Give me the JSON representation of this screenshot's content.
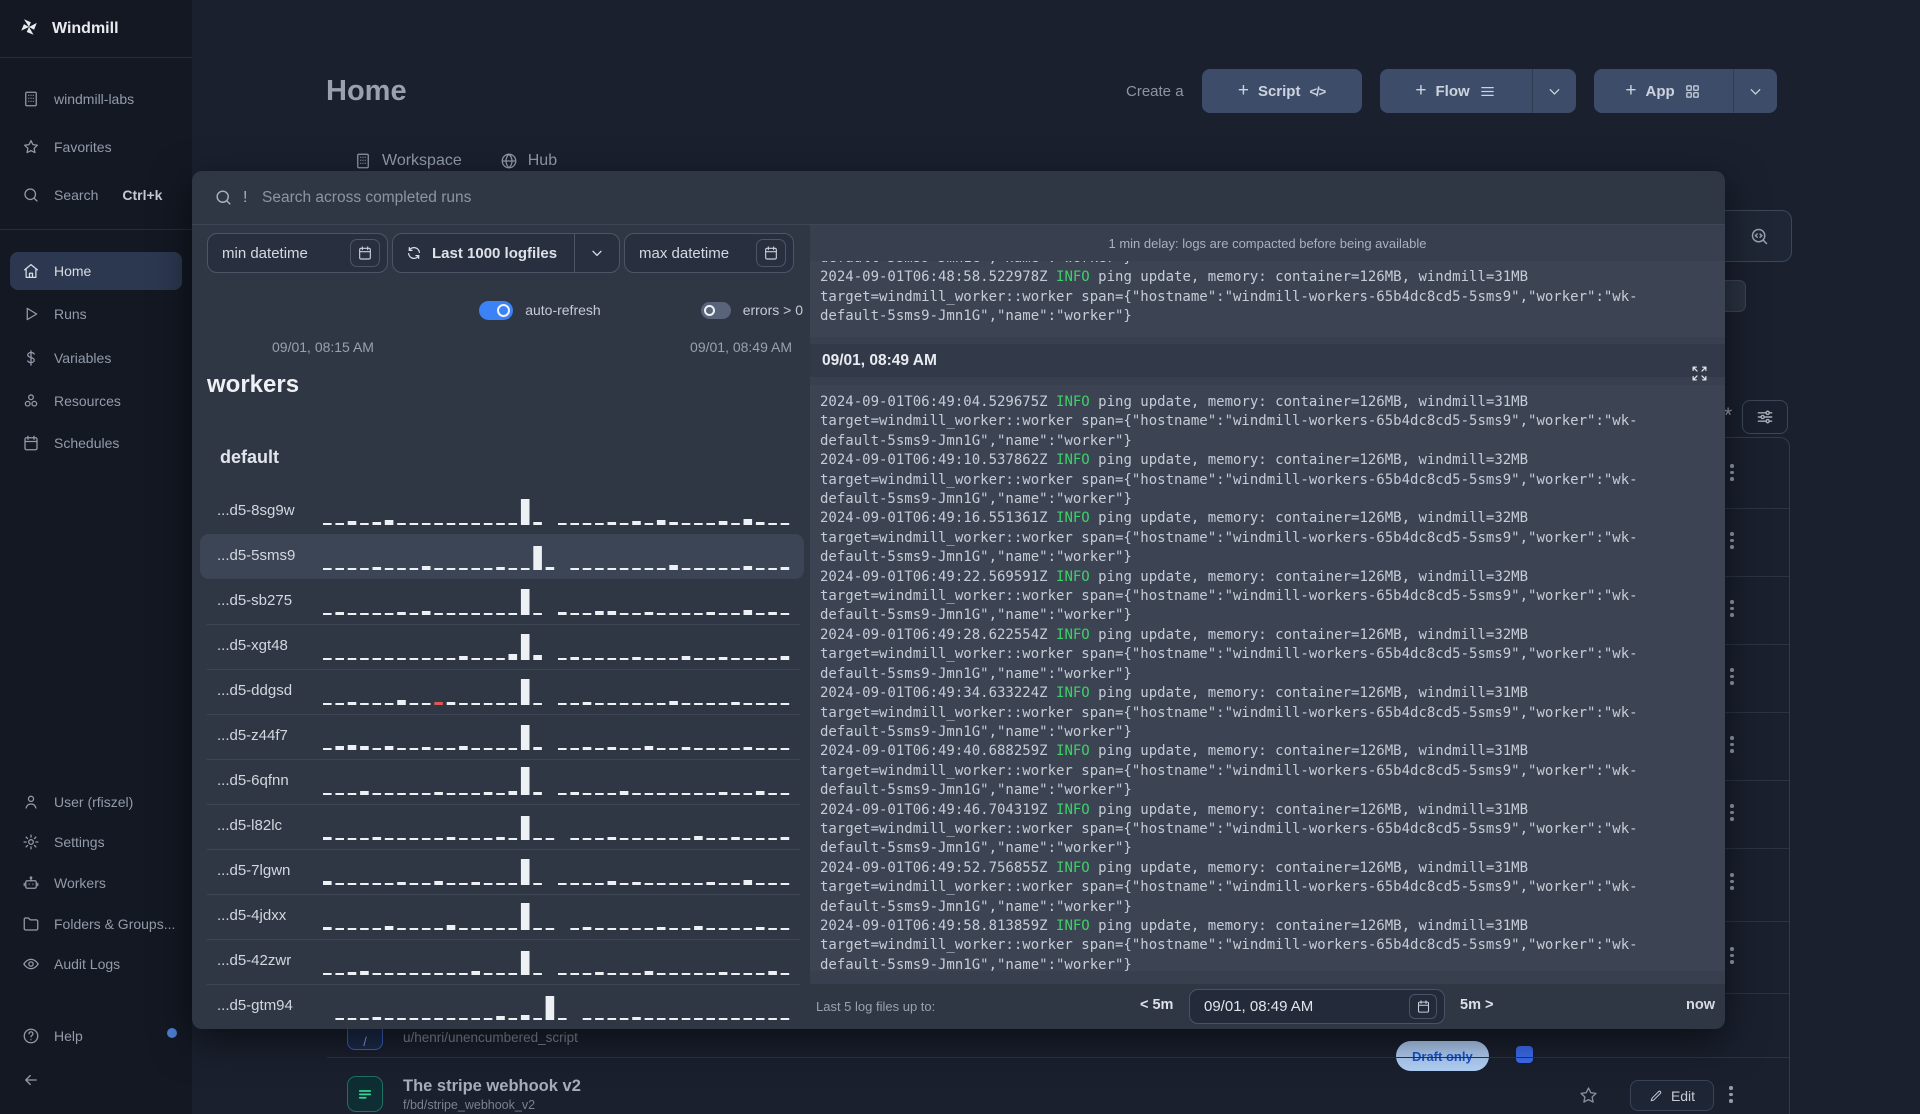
{
  "sidebar": {
    "brand": "Windmill",
    "top_items": [
      {
        "label": "windmill-labs",
        "icon": "building"
      },
      {
        "label": "Favorites",
        "icon": "star"
      },
      {
        "label": "Search",
        "icon": "search",
        "shortcut": "Ctrl+k"
      }
    ],
    "nav_items": [
      {
        "label": "Home",
        "icon": "home",
        "active": true
      },
      {
        "label": "Runs",
        "icon": "play"
      },
      {
        "label": "Variables",
        "icon": "dollar"
      },
      {
        "label": "Resources",
        "icon": "nodes"
      },
      {
        "label": "Schedules",
        "icon": "calendar"
      }
    ],
    "bottom_items": [
      {
        "label": "User (rfiszel)",
        "icon": "user"
      },
      {
        "label": "Settings",
        "icon": "gear"
      },
      {
        "label": "Workers",
        "icon": "robot"
      },
      {
        "label": "Folders & Groups...",
        "icon": "folder"
      },
      {
        "label": "Audit Logs",
        "icon": "eye"
      }
    ],
    "help_label": "Help"
  },
  "header": {
    "title": "Home",
    "create_label": "Create a",
    "script_label": "Script",
    "script_glyph": "</>",
    "flow_label": "Flow",
    "app_label": "App"
  },
  "tabs": [
    {
      "label": "Workspace",
      "icon": "building"
    },
    {
      "label": "Hub",
      "icon": "globe"
    }
  ],
  "modal": {
    "search_prefix": "!",
    "search_placeholder": "Search across completed runs",
    "filters": {
      "min_datetime": "min datetime",
      "logfiles": "Last 1000 logfiles",
      "max_datetime": "max datetime",
      "auto_refresh": "auto-refresh",
      "errors": "errors > 0"
    },
    "range": {
      "start": "09/01, 08:15 AM",
      "end": "09/01, 08:49 AM"
    },
    "workers": {
      "title": "workers",
      "group": "default",
      "rows": [
        {
          "id": "...d5-8sg9w",
          "selected": false,
          "bars": [
            2,
            2,
            4,
            2,
            3,
            5,
            2,
            2,
            2,
            2,
            2,
            2,
            2,
            2,
            2,
            2,
            26,
            3,
            0,
            2,
            2,
            2,
            2,
            3,
            2,
            4,
            2,
            5,
            3,
            2,
            2,
            2,
            4,
            2,
            6,
            3,
            2,
            2
          ]
        },
        {
          "id": "...d5-5sms9",
          "selected": true,
          "bars": [
            2,
            2,
            2,
            2,
            3,
            2,
            2,
            2,
            4,
            2,
            2,
            2,
            2,
            2,
            3,
            2,
            2,
            24,
            3,
            0,
            2,
            2,
            2,
            2,
            2,
            2,
            2,
            2,
            5,
            2,
            2,
            2,
            2,
            2,
            4,
            2,
            2,
            3
          ]
        },
        {
          "id": "...d5-sb275",
          "selected": false,
          "bars": [
            2,
            3,
            2,
            2,
            2,
            2,
            3,
            2,
            4,
            2,
            2,
            2,
            2,
            2,
            2,
            2,
            26,
            2,
            0,
            3,
            2,
            2,
            4,
            4,
            2,
            2,
            3,
            2,
            2,
            2,
            2,
            3,
            2,
            2,
            5,
            2,
            3,
            2
          ]
        },
        {
          "id": "...d5-xgt48",
          "selected": false,
          "bars": [
            2,
            2,
            2,
            2,
            2,
            2,
            2,
            2,
            2,
            2,
            2,
            4,
            2,
            2,
            2,
            6,
            26,
            5,
            0,
            2,
            3,
            2,
            2,
            2,
            2,
            3,
            2,
            2,
            2,
            4,
            2,
            2,
            3,
            2,
            2,
            2,
            2,
            4
          ]
        },
        {
          "id": "...d5-ddgsd",
          "selected": false,
          "bars": [
            2,
            2,
            3,
            2,
            2,
            2,
            5,
            2,
            2,
            -2,
            3,
            2,
            2,
            2,
            2,
            2,
            26,
            2,
            0,
            2,
            2,
            3,
            2,
            2,
            2,
            2,
            2,
            2,
            4,
            2,
            2,
            2,
            2,
            3,
            2,
            2,
            2,
            2
          ]
        },
        {
          "id": "...d5-z44f7",
          "selected": false,
          "bars": [
            2,
            4,
            5,
            4,
            2,
            4,
            2,
            2,
            3,
            2,
            2,
            4,
            2,
            2,
            2,
            2,
            25,
            3,
            0,
            2,
            2,
            3,
            2,
            3,
            2,
            2,
            4,
            2,
            2,
            3,
            2,
            2,
            2,
            2,
            3,
            2,
            2,
            2
          ]
        },
        {
          "id": "...d5-6qfnn",
          "selected": false,
          "bars": [
            2,
            2,
            2,
            4,
            2,
            2,
            2,
            2,
            2,
            3,
            2,
            2,
            2,
            3,
            2,
            4,
            28,
            3,
            0,
            2,
            3,
            2,
            2,
            2,
            4,
            2,
            2,
            2,
            2,
            2,
            2,
            2,
            3,
            2,
            2,
            4,
            2,
            2
          ]
        },
        {
          "id": "...d5-l82lc",
          "selected": false,
          "bars": [
            3,
            2,
            2,
            2,
            3,
            2,
            2,
            2,
            2,
            2,
            3,
            2,
            2,
            2,
            3,
            2,
            24,
            2,
            2,
            0,
            2,
            2,
            2,
            3,
            2,
            2,
            2,
            2,
            2,
            2,
            4,
            2,
            2,
            3,
            2,
            2,
            2,
            3
          ]
        },
        {
          "id": "...d5-7lgwn",
          "selected": false,
          "bars": [
            4,
            2,
            2,
            2,
            2,
            2,
            3,
            2,
            2,
            4,
            2,
            2,
            3,
            2,
            2,
            2,
            26,
            2,
            0,
            2,
            2,
            2,
            2,
            4,
            2,
            3,
            2,
            2,
            2,
            2,
            2,
            3,
            2,
            2,
            5,
            2,
            2,
            2
          ]
        },
        {
          "id": "...d5-4jdxx",
          "selected": false,
          "bars": [
            3,
            2,
            2,
            2,
            2,
            4,
            2,
            2,
            2,
            2,
            5,
            2,
            2,
            2,
            2,
            2,
            27,
            2,
            2,
            0,
            2,
            3,
            2,
            2,
            2,
            2,
            2,
            3,
            2,
            2,
            4,
            2,
            2,
            2,
            2,
            3,
            2,
            2
          ]
        },
        {
          "id": "...d5-42zwr",
          "selected": false,
          "bars": [
            2,
            2,
            3,
            4,
            2,
            2,
            2,
            2,
            2,
            2,
            2,
            2,
            4,
            2,
            2,
            2,
            24,
            2,
            0,
            2,
            2,
            2,
            3,
            2,
            2,
            2,
            4,
            2,
            2,
            2,
            2,
            2,
            3,
            2,
            2,
            2,
            4,
            2
          ]
        },
        {
          "id": "...d5-gtm94",
          "selected": false,
          "bars": [
            0,
            2,
            2,
            2,
            3,
            2,
            2,
            2,
            2,
            2,
            2,
            2,
            2,
            2,
            4,
            2,
            5,
            2,
            24,
            2,
            0,
            2,
            2,
            2,
            2,
            3,
            2,
            2,
            2,
            2,
            2,
            2,
            2,
            2,
            2,
            2,
            2,
            2
          ]
        }
      ]
    },
    "log": {
      "notice": "1 min delay: logs are compacted before being available",
      "level": "INFO",
      "msg_before": "ping update, memory: container=126MB, windmill=",
      "line2": "target=windmill_worker::worker span={\"hostname\":\"windmill-workers-65b4dc8cd5-5sms9\",\"worker\":\"wk-",
      "line3": "default-5sms9-Jmn1G\",\"name\":\"worker\"}",
      "clipped_line": "default-5sms9-Jmn1G\",\"name\":\"worker\"}",
      "top_entries": [
        {
          "ts": "2024-09-01T06:48:58.522978Z",
          "windmill": "31MB"
        }
      ],
      "section_header": "09/01, 08:49 AM",
      "entries": [
        {
          "ts": "2024-09-01T06:49:04.529675Z",
          "windmill": "31MB"
        },
        {
          "ts": "2024-09-01T06:49:10.537862Z",
          "windmill": "32MB"
        },
        {
          "ts": "2024-09-01T06:49:16.551361Z",
          "windmill": "32MB"
        },
        {
          "ts": "2024-09-01T06:49:22.569591Z",
          "windmill": "32MB"
        },
        {
          "ts": "2024-09-01T06:49:28.622554Z",
          "windmill": "32MB"
        },
        {
          "ts": "2024-09-01T06:49:34.633224Z",
          "windmill": "31MB"
        },
        {
          "ts": "2024-09-01T06:49:40.688259Z",
          "windmill": "31MB"
        },
        {
          "ts": "2024-09-01T06:49:46.704319Z",
          "windmill": "31MB"
        },
        {
          "ts": "2024-09-01T06:49:52.756855Z",
          "windmill": "31MB"
        },
        {
          "ts": "2024-09-01T06:49:58.813859Z",
          "windmill": "31MB"
        }
      ],
      "footer": {
        "label": "Last 5 log files up to:",
        "back": "< 5m",
        "datetime": "09/01, 08:49 AM",
        "forward": "5m >",
        "now": "now"
      }
    }
  },
  "background": {
    "draft_badge": "Draft only",
    "henri_path": "u/henri/unencumbered_script",
    "stripe_title": "The stripe webhook v2",
    "stripe_path": "f/bd/stripe_webhook_v2",
    "edit_label": "Edit"
  },
  "colors": {
    "accent_blue": "#3b82f6",
    "info_green": "#3fd168",
    "bar_white": "#eef1f4",
    "bar_error": "#e05555"
  }
}
